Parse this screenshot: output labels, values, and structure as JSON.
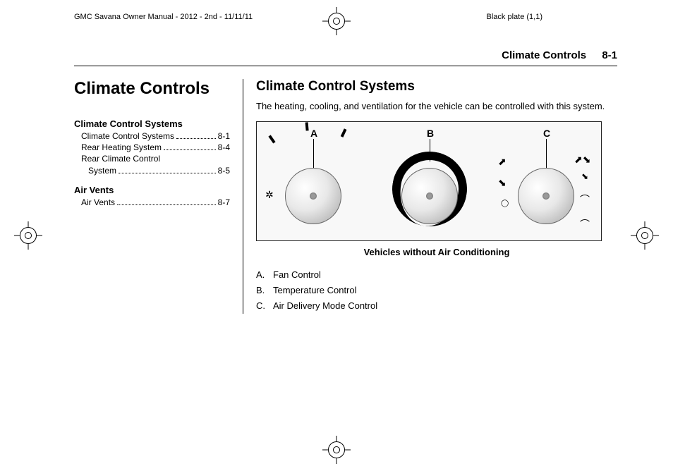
{
  "meta": {
    "manual_line": "GMC Savana Owner Manual - 2012 - 2nd - 11/11/11",
    "plate": "Black plate (1,1)"
  },
  "running_head": {
    "title": "Climate Controls",
    "page": "8-1"
  },
  "chapter_title": "Climate Controls",
  "toc": {
    "group1_title": "Climate Control Systems",
    "g1_item1_label": "Climate Control Systems",
    "g1_item1_page": "8-1",
    "g1_item2_label": "Rear Heating System",
    "g1_item2_page": "8-4",
    "g1_item3_label1": "Rear Climate Control",
    "g1_item3_label2": "System",
    "g1_item3_page": "8-5",
    "group2_title": "Air Vents",
    "g2_item1_label": "Air Vents",
    "g2_item1_page": "8-7"
  },
  "section_heading": "Climate Control Systems",
  "intro_text": "The heating, cooling, and ventilation for the vehicle can be controlled with this system.",
  "figure": {
    "label_a": "A",
    "label_b": "B",
    "label_c": "C",
    "caption": "Vehicles without Air Conditioning"
  },
  "legend": {
    "a_letter": "A.",
    "a_text": "Fan Control",
    "b_letter": "B.",
    "b_text": "Temperature Control",
    "c_letter": "C.",
    "c_text": "Air Delivery Mode Control"
  }
}
